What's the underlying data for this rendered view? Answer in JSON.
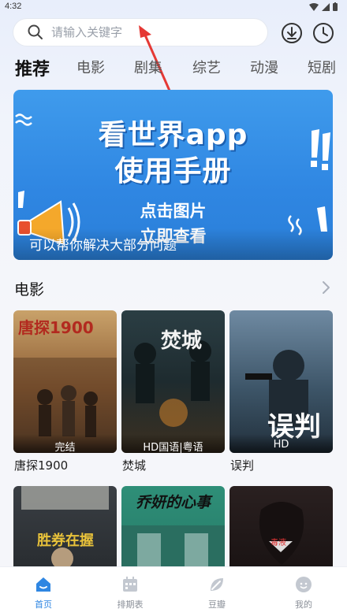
{
  "status_bar": {
    "time": "4:32"
  },
  "search": {
    "placeholder": "请输入关键字"
  },
  "header": {
    "download_icon": "download-icon",
    "history_icon": "clock-icon"
  },
  "tabs": [
    {
      "label": "推荐",
      "active": true
    },
    {
      "label": "电影"
    },
    {
      "label": "剧集"
    },
    {
      "label": "综艺"
    },
    {
      "label": "动漫"
    },
    {
      "label": "短剧"
    }
  ],
  "banner": {
    "title_line1": "看世界app",
    "title_line2": "使用手册",
    "sub_line1": "点击图片",
    "sub_line2": "立即查看",
    "caption": "可以帮你解决大部分问题"
  },
  "section": {
    "title": "电影"
  },
  "movies": [
    {
      "title": "唐探1900",
      "badge": "完结",
      "poster_text": "唐探1900"
    },
    {
      "title": "焚城",
      "badge": "HD国语|粤语",
      "poster_text": "焚城"
    },
    {
      "title": "误判",
      "badge": "HD",
      "poster_text": "误判"
    },
    {
      "title": "",
      "badge": "",
      "poster_text": ""
    },
    {
      "title": "",
      "badge": "",
      "poster_text": "乔妍的心事"
    },
    {
      "title": "",
      "badge": "",
      "poster_text": ""
    }
  ],
  "bottom_nav": [
    {
      "label": "首页",
      "icon": "home-icon",
      "active": true
    },
    {
      "label": "排期表",
      "icon": "calendar-icon"
    },
    {
      "label": "豆瓣",
      "icon": "douban-leaf-icon"
    },
    {
      "label": "我的",
      "icon": "profile-icon"
    }
  ],
  "colors": {
    "accent": "#2f86e2",
    "banner_bg": "#3f9bec",
    "annotation_arrow": "#e53935"
  }
}
